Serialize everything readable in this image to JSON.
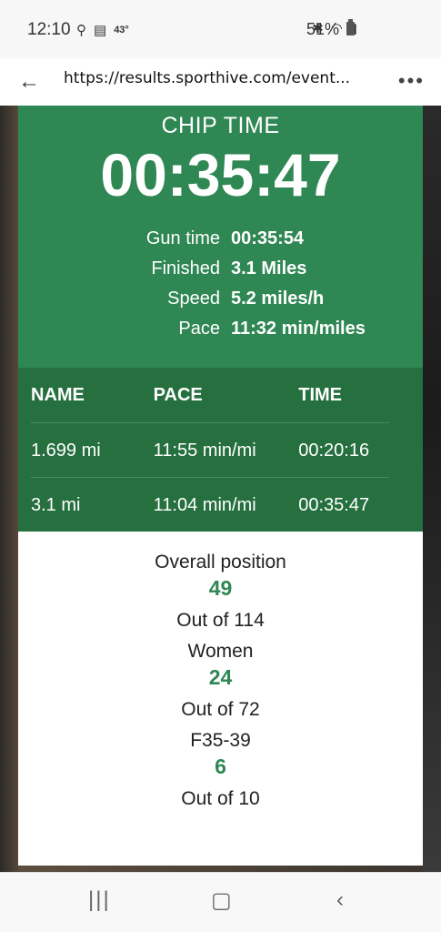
{
  "status_bar": {
    "time": "12:10",
    "temp": "43°",
    "battery": "51%"
  },
  "browser": {
    "url": "https://results.sporthive.com/event..."
  },
  "chip": {
    "label": "CHIP TIME",
    "time": "00:35:47",
    "rows": [
      {
        "label": "Gun time",
        "value": "00:35:54"
      },
      {
        "label": "Finished",
        "value": "3.1 Miles"
      },
      {
        "label": "Speed",
        "value": "5.2 miles/h"
      },
      {
        "label": "Pace",
        "value": "11:32 min/miles"
      }
    ]
  },
  "splits": {
    "headers": [
      "NAME",
      "PACE",
      "TIME"
    ],
    "rows": [
      [
        "1.699 mi",
        "11:55 min/mi",
        "00:20:16"
      ],
      [
        "3.1 mi",
        "11:04 min/mi",
        "00:35:47"
      ]
    ]
  },
  "positions": [
    {
      "title": "Overall position",
      "value": "49",
      "out_of": "Out of 114"
    },
    {
      "title": "Women",
      "value": "24",
      "out_of": "Out of 72"
    },
    {
      "title": "F35-39",
      "value": "6",
      "out_of": "Out of 10"
    }
  ],
  "colors": {
    "green": "#2f8753",
    "dark_green": "#26703f"
  }
}
